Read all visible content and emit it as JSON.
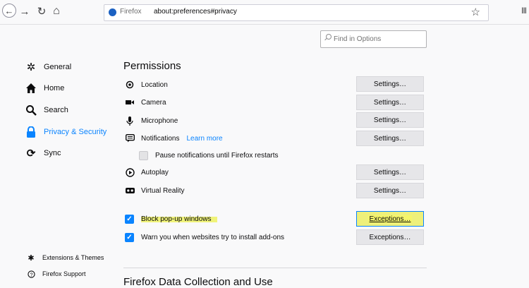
{
  "toolbar": {
    "back": "←",
    "forward": "→",
    "reload": "↻",
    "home": "⌂",
    "brand": "Firefox",
    "url": "about:preferences#privacy",
    "bookmark_star": "☆",
    "library": "III"
  },
  "search": {
    "placeholder": "Find in Options"
  },
  "sidebar": {
    "items": [
      {
        "label": "General",
        "icon": "gear-icon"
      },
      {
        "label": "Home",
        "icon": "home-icon"
      },
      {
        "label": "Search",
        "icon": "search-icon"
      },
      {
        "label": "Privacy & Security",
        "icon": "lock-icon",
        "active": true
      },
      {
        "label": "Sync",
        "icon": "sync-icon"
      }
    ],
    "footer": [
      {
        "label": "Extensions & Themes",
        "icon": "puzzle-icon"
      },
      {
        "label": "Firefox Support",
        "icon": "help-icon"
      }
    ]
  },
  "permissions": {
    "title": "Permissions",
    "rows": [
      {
        "label": "Location",
        "button": "Settings…",
        "icon": "location-icon"
      },
      {
        "label": "Camera",
        "button": "Settings…",
        "icon": "camera-icon"
      },
      {
        "label": "Microphone",
        "button": "Settings…",
        "icon": "microphone-icon"
      },
      {
        "label": "Notifications",
        "learn_more": "Learn more",
        "button": "Settings…",
        "icon": "notifications-icon"
      },
      {
        "label": "Pause notifications until Firefox restarts",
        "checked": false
      },
      {
        "label": "Autoplay",
        "button": "Settings…",
        "icon": "autoplay-icon"
      },
      {
        "label": "Virtual Reality",
        "button": "Settings…",
        "icon": "vr-icon"
      },
      {
        "label": "Block pop-up windows",
        "button": "Exceptions…",
        "checked": true
      },
      {
        "label": "Warn you when websites try to install add-ons",
        "button": "Exceptions…",
        "checked": true
      }
    ]
  },
  "next_section": {
    "title": "Firefox Data Collection and Use"
  },
  "colors": {
    "accent": "#0a84ff",
    "highlight": "#f0f37a"
  }
}
